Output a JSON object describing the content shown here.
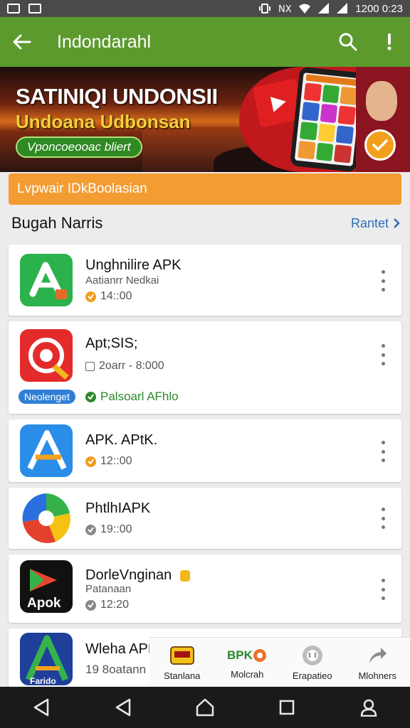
{
  "status_bar": {
    "time": "1200 0:23"
  },
  "app_bar": {
    "title": "Indondarahl"
  },
  "banner": {
    "title": "SATINIQI UNDONSII",
    "subtitle": "Undoana Udbonsan",
    "pill": "Vponcoeooac bliert"
  },
  "orange_bar": {
    "text": "Lvpwair IDkBoolasian"
  },
  "section": {
    "title": "Bugah Narris",
    "link": "Rantet"
  },
  "apps": [
    {
      "name": "Unghnilire APK",
      "sub": "Aatianrr Nedkai",
      "meta": "14::00",
      "meta_color": "#f29b1a"
    },
    {
      "name": "Apt;SIS;",
      "meta": "2oarr - 8:000",
      "tag": "Neolenget",
      "green": "Palsoarl AFhlo"
    },
    {
      "name": "APK. APtK.",
      "meta": "12::00",
      "meta_color": "#f29b1a"
    },
    {
      "name": "PhtlhIAPK",
      "meta": "19::00",
      "meta_color": "#888888"
    },
    {
      "name": "DorleVnginan",
      "sub": "Patanaan",
      "meta": "12:20",
      "meta_color": "#888888",
      "icon_text": "Apok"
    },
    {
      "name": "Wleha APK",
      "meta": "19 8oatann",
      "icon_text": "Farido"
    }
  ],
  "tabs": [
    {
      "label": "Stanlana",
      "icon": "coupon-icon"
    },
    {
      "label": "Molcrah",
      "icon": "brand-badge-icon"
    },
    {
      "label": "Erapatieo",
      "icon": "circle-logo-icon"
    },
    {
      "label": "Mlohners",
      "icon": "share-icon"
    }
  ],
  "colors": {
    "app_bar": "#5c9a2e",
    "orange_bar": "#f39c32",
    "link": "#2d6fb8"
  }
}
